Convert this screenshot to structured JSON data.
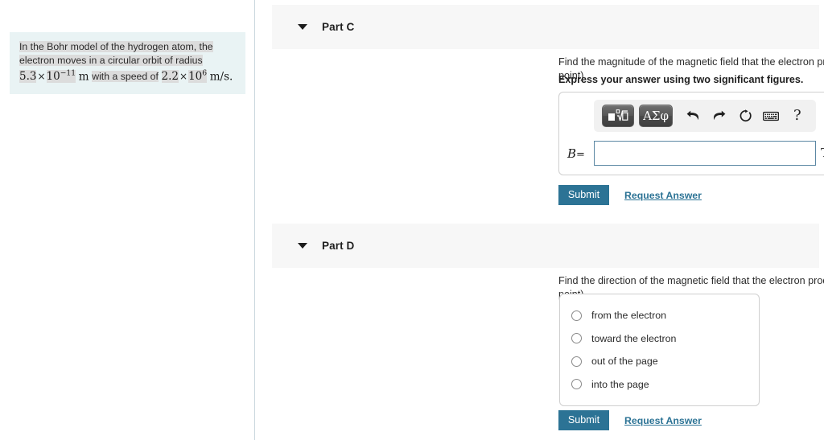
{
  "problem": {
    "line1": "In the Bohr model of the hydrogen atom, the",
    "line2": "electron moves in a circular orbit of radius",
    "radius_mantissa": "5.3",
    "radius_times": "×",
    "radius_base": "10",
    "radius_exponent": "−11",
    "radius_unit": "m",
    "mid_text": "with a speed of",
    "speed_mantissa": "2.2",
    "speed_times": "×",
    "speed_base": "10",
    "speed_exponent": "6",
    "speed_unit": "m/s."
  },
  "parts": {
    "c": {
      "title": "Part C",
      "question": "Find the magnitude of the magnetic field that the electron produces at the location of the nucleus (treated as a point).",
      "instruction": "Express your answer using two significant figures.",
      "toolbar": {
        "template_button": "template-math-icon",
        "template_label": "□√□",
        "greek_label": "ΑΣφ",
        "undo_label": "undo-icon",
        "redo_label": "redo-icon",
        "reset_label": "reset-icon",
        "keyboard_label": "keyboard-icon",
        "help_label": "?"
      },
      "variable": "B",
      "equals": "=",
      "value": "",
      "placeholder": "",
      "unit": "T",
      "submit_label": "Submit",
      "request_label": "Request Answer"
    },
    "d": {
      "title": "Part D",
      "question": "Find the direction of the magnetic field that the electron produces at the location of the nucleus (treated as a point).",
      "choices": [
        {
          "label": "from the electron",
          "selected": false
        },
        {
          "label": "toward the electron",
          "selected": false
        },
        {
          "label": "out of the page",
          "selected": false
        },
        {
          "label": "into the page",
          "selected": false
        }
      ],
      "submit_label": "Submit",
      "request_label": "Request Answer"
    }
  },
  "colors": {
    "accent": "#2c7395",
    "header_bg": "#f7f7f7",
    "problem_bg": "#e9f3f4",
    "highlight": "#dcdcdc",
    "input_border": "#5b87a3"
  }
}
